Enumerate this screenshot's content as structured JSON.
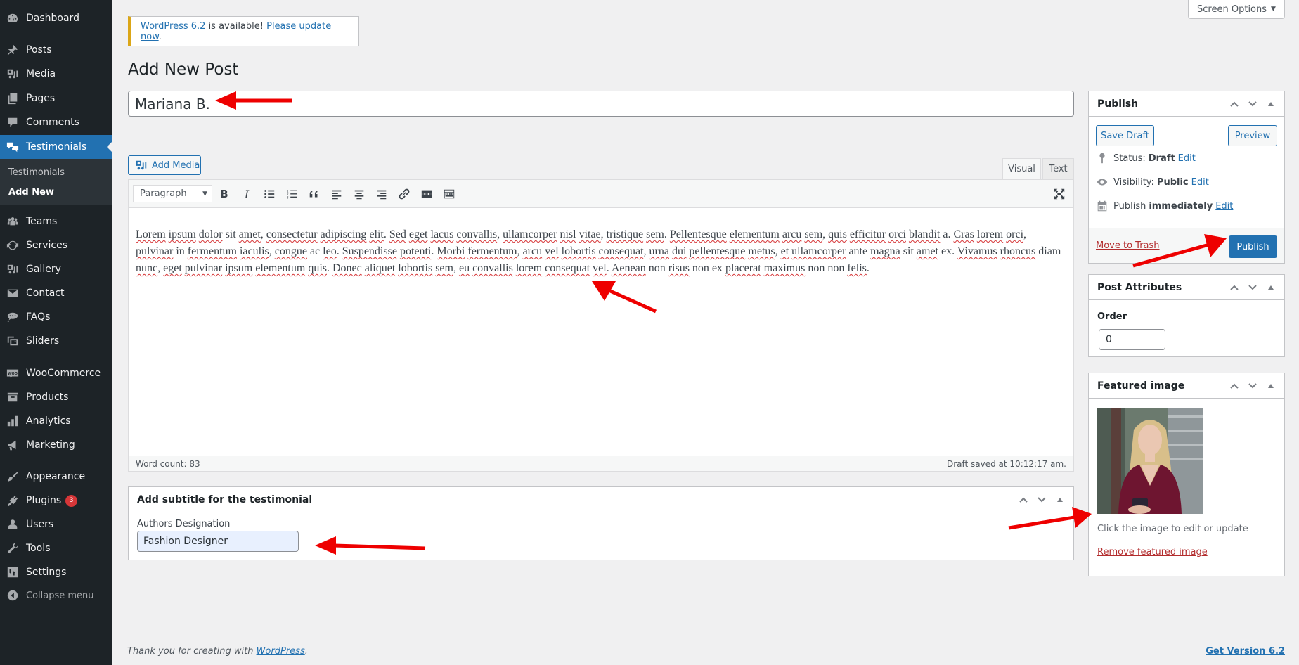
{
  "sidebar": {
    "items": [
      {
        "label": "Dashboard",
        "icon": "dashboard-icon"
      },
      {
        "label": "Posts",
        "icon": "pin-icon"
      },
      {
        "label": "Media",
        "icon": "media-icon"
      },
      {
        "label": "Pages",
        "icon": "pages-icon"
      },
      {
        "label": "Comments",
        "icon": "comment-icon"
      },
      {
        "label": "Testimonials",
        "icon": "testimonials-icon",
        "current": true
      },
      {
        "label": "Teams",
        "icon": "groups-icon"
      },
      {
        "label": "Services",
        "icon": "update-icon"
      },
      {
        "label": "Gallery",
        "icon": "gallery-icon"
      },
      {
        "label": "Contact",
        "icon": "email-icon"
      },
      {
        "label": "FAQs",
        "icon": "format-chat-icon"
      },
      {
        "label": "Sliders",
        "icon": "images-icon"
      },
      {
        "label": "WooCommerce",
        "icon": "woo-icon"
      },
      {
        "label": "Products",
        "icon": "archive-icon"
      },
      {
        "label": "Analytics",
        "icon": "chart-bar-icon"
      },
      {
        "label": "Marketing",
        "icon": "megaphone-icon"
      },
      {
        "label": "Appearance",
        "icon": "paintbrush-icon"
      },
      {
        "label": "Plugins",
        "icon": "plugin-icon",
        "badge": "3"
      },
      {
        "label": "Users",
        "icon": "user-icon"
      },
      {
        "label": "Tools",
        "icon": "wrench-icon"
      },
      {
        "label": "Settings",
        "icon": "settings-icon"
      }
    ],
    "submenu": [
      {
        "label": "Testimonials"
      },
      {
        "label": "Add New",
        "current": true
      }
    ],
    "collapse_label": "Collapse menu"
  },
  "screen_options": {
    "label": "Screen Options"
  },
  "notice": {
    "link1": "WordPress 6.2",
    "middle": " is available! ",
    "link2": "Please update now",
    "end": "."
  },
  "page_title": "Add New Post",
  "post_title": {
    "value": "Mariana B."
  },
  "editor": {
    "add_media_label": "Add Media",
    "tabs": {
      "visual": "Visual",
      "text": "Text"
    },
    "format_select": "Paragraph",
    "toolbar_buttons": [
      "bold",
      "italic",
      "bulleted-list",
      "numbered-list",
      "blockquote",
      "align-left",
      "align-center",
      "align-right",
      "insert-link",
      "read-more",
      "toolbar-toggle"
    ],
    "content": "Lorem ipsum dolor sit amet, consectetur adipiscing elit. Sed eget lacus convallis, ullamcorper nisl vitae, tristique sem. Pellentesque elementum arcu sem, quis efficitur orci blandit a. Cras lorem orci, pulvinar in fermentum iaculis, congue ac leo. Suspendisse potenti. Morbi fermentum, arcu vel lobortis consequat, urna dui pellentesque metus, et ullamcorper ante magna sit amet ex. Vivamus rhoncus diam nunc, eget pulvinar ipsum elementum quis. Donec aliquet lobortis sem, eu convallis lorem consequat vel. Aenean non risus non ex placerat maximus non non felis.",
    "word_count": "Word count: 83",
    "draft_saved": "Draft saved at 10:12:17 am."
  },
  "subtitle_box": {
    "title": "Add subtitle for the testimonial",
    "field_label": "Authors Designation",
    "field_value": "Fashion Designer"
  },
  "publish": {
    "title": "Publish",
    "save_draft": "Save Draft",
    "preview": "Preview",
    "status_label": "Status:",
    "status_value": "Draft",
    "visibility_label": "Visibility:",
    "visibility_value": "Public",
    "publish_label": "Publish",
    "publish_value": "immediately",
    "edit": "Edit",
    "move_to_trash": "Move to Trash",
    "publish_button": "Publish"
  },
  "post_attributes": {
    "title": "Post Attributes",
    "order_label": "Order",
    "order_value": "0"
  },
  "featured_image": {
    "title": "Featured image",
    "help": "Click the image to edit or update",
    "remove": "Remove featured image"
  },
  "footer": {
    "thanks": "Thank you for creating with ",
    "wp_link": "WordPress",
    "end": ".",
    "version_link": "Get Version 6.2"
  },
  "colors": {
    "sidebar_bg": "#1d2327",
    "accent": "#2271b1",
    "notice_border": "#dba617",
    "danger": "#b32d2e",
    "annotation_arrow": "#ee0000"
  }
}
